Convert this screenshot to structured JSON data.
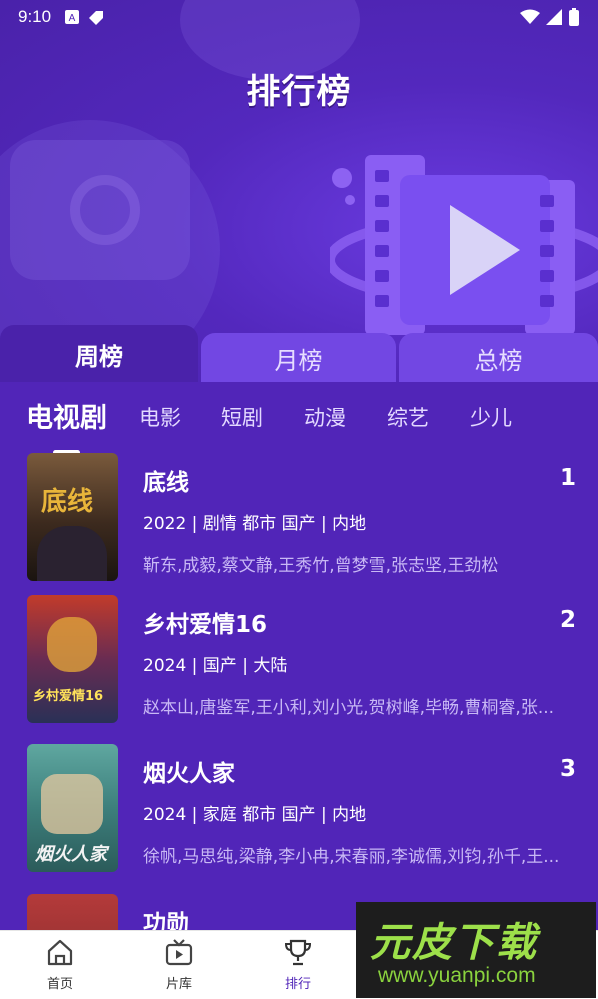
{
  "status_bar": {
    "time": "9:10"
  },
  "header": {
    "title": "排行榜"
  },
  "period_tabs": [
    {
      "label": "周榜",
      "active": true
    },
    {
      "label": "月榜",
      "active": false
    },
    {
      "label": "总榜",
      "active": false
    }
  ],
  "category_tabs": [
    {
      "label": "电视剧",
      "active": true
    },
    {
      "label": "电影"
    },
    {
      "label": "短剧"
    },
    {
      "label": "动漫"
    },
    {
      "label": "综艺"
    },
    {
      "label": "少儿"
    }
  ],
  "items": [
    {
      "rank": "1",
      "title": "底线",
      "meta": "2022 | 剧情 都市 国产 | 内地",
      "cast": "靳东,成毅,蔡文静,王秀竹,曾梦雪,张志坚,王劲松",
      "poster_text": "底线"
    },
    {
      "rank": "2",
      "title": "乡村爱情16",
      "meta": "2024 | 国产 | 大陆",
      "cast": "赵本山,唐鉴军,王小利,刘小光,贺树峰,毕畅,曹桐睿,张...",
      "poster_text": "乡村爱情16"
    },
    {
      "rank": "3",
      "title": "烟火人家",
      "meta": "2024 | 家庭 都市 国产 | 内地",
      "cast": "徐帆,马思纯,梁静,李小冉,宋春丽,李诚儒,刘钧,孙千,王...",
      "poster_text": "烟火人家"
    },
    {
      "rank": "",
      "title": "功勋",
      "meta": "",
      "cast": "",
      "poster_text": ""
    }
  ],
  "bottom_nav": [
    {
      "label": "首页",
      "icon": "home-icon",
      "active": false
    },
    {
      "label": "片库",
      "icon": "tv-icon",
      "active": false
    },
    {
      "label": "排行",
      "icon": "trophy-icon",
      "active": true
    }
  ],
  "watermark": {
    "title": "元皮下载",
    "url": "www.yuanpi.com"
  },
  "colors": {
    "primary": "#5125b8",
    "tab_inactive": "#7247e3",
    "active_nav": "#5125b8"
  }
}
